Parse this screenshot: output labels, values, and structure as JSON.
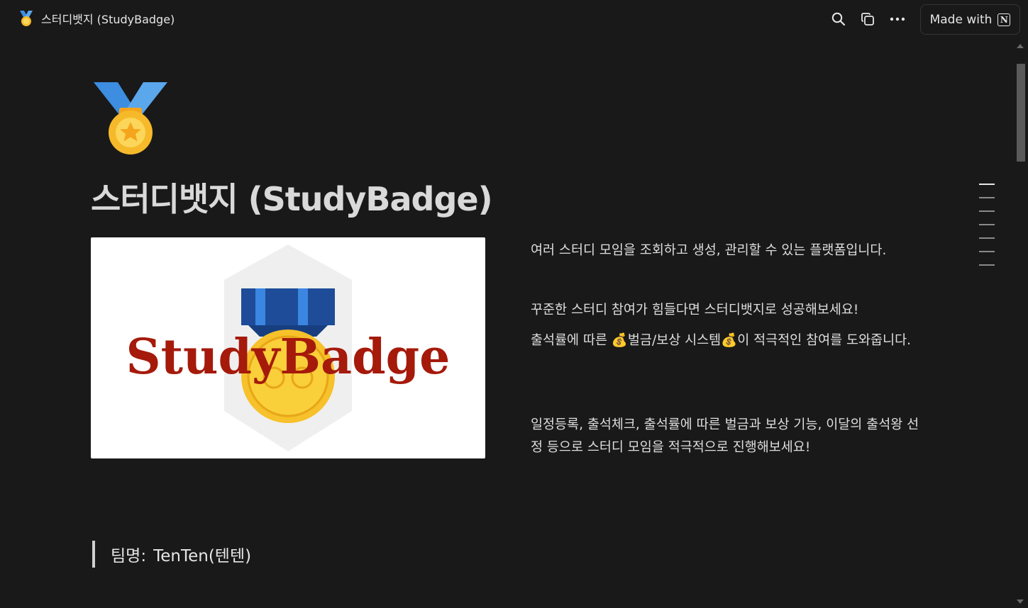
{
  "topbar": {
    "page_title": "스터디뱃지 (StudyBadge)",
    "made_with_label": "Made with",
    "icons": [
      "search-icon",
      "duplicate-icon",
      "more-icon",
      "notion-logo-icon"
    ]
  },
  "page": {
    "icon": "medal-icon",
    "title": "스터디뱃지 (StudyBadge)",
    "cover": {
      "logo_text": "StudyBadge",
      "colors": {
        "logo_text": "#a51a0b",
        "ribbon_dark": "#1e4c98",
        "ribbon_light": "#3b86e0",
        "coin": "#f6c12a"
      }
    },
    "paragraphs": [
      "여러 스터디 모임을 조회하고 생성, 관리할 수 있는 플랫폼입니다.",
      "꾸준한 스터디 참여가 힘들다면 스터디뱃지로 성공해보세요!",
      "출석률에 따른 💰벌금/보상 시스템💰이 적극적인 참여를 도와줍니다.",
      "일정등록, 출석체크, 출석률에 따른 벌금과 보상 기능, 이달의 출석왕 선정 등으로 스터디 모임을 적극적으로 진행해보세요!"
    ],
    "team": {
      "label": "팀명:",
      "value": "TenTen(텐텐)"
    }
  },
  "toc": {
    "count": 7
  }
}
